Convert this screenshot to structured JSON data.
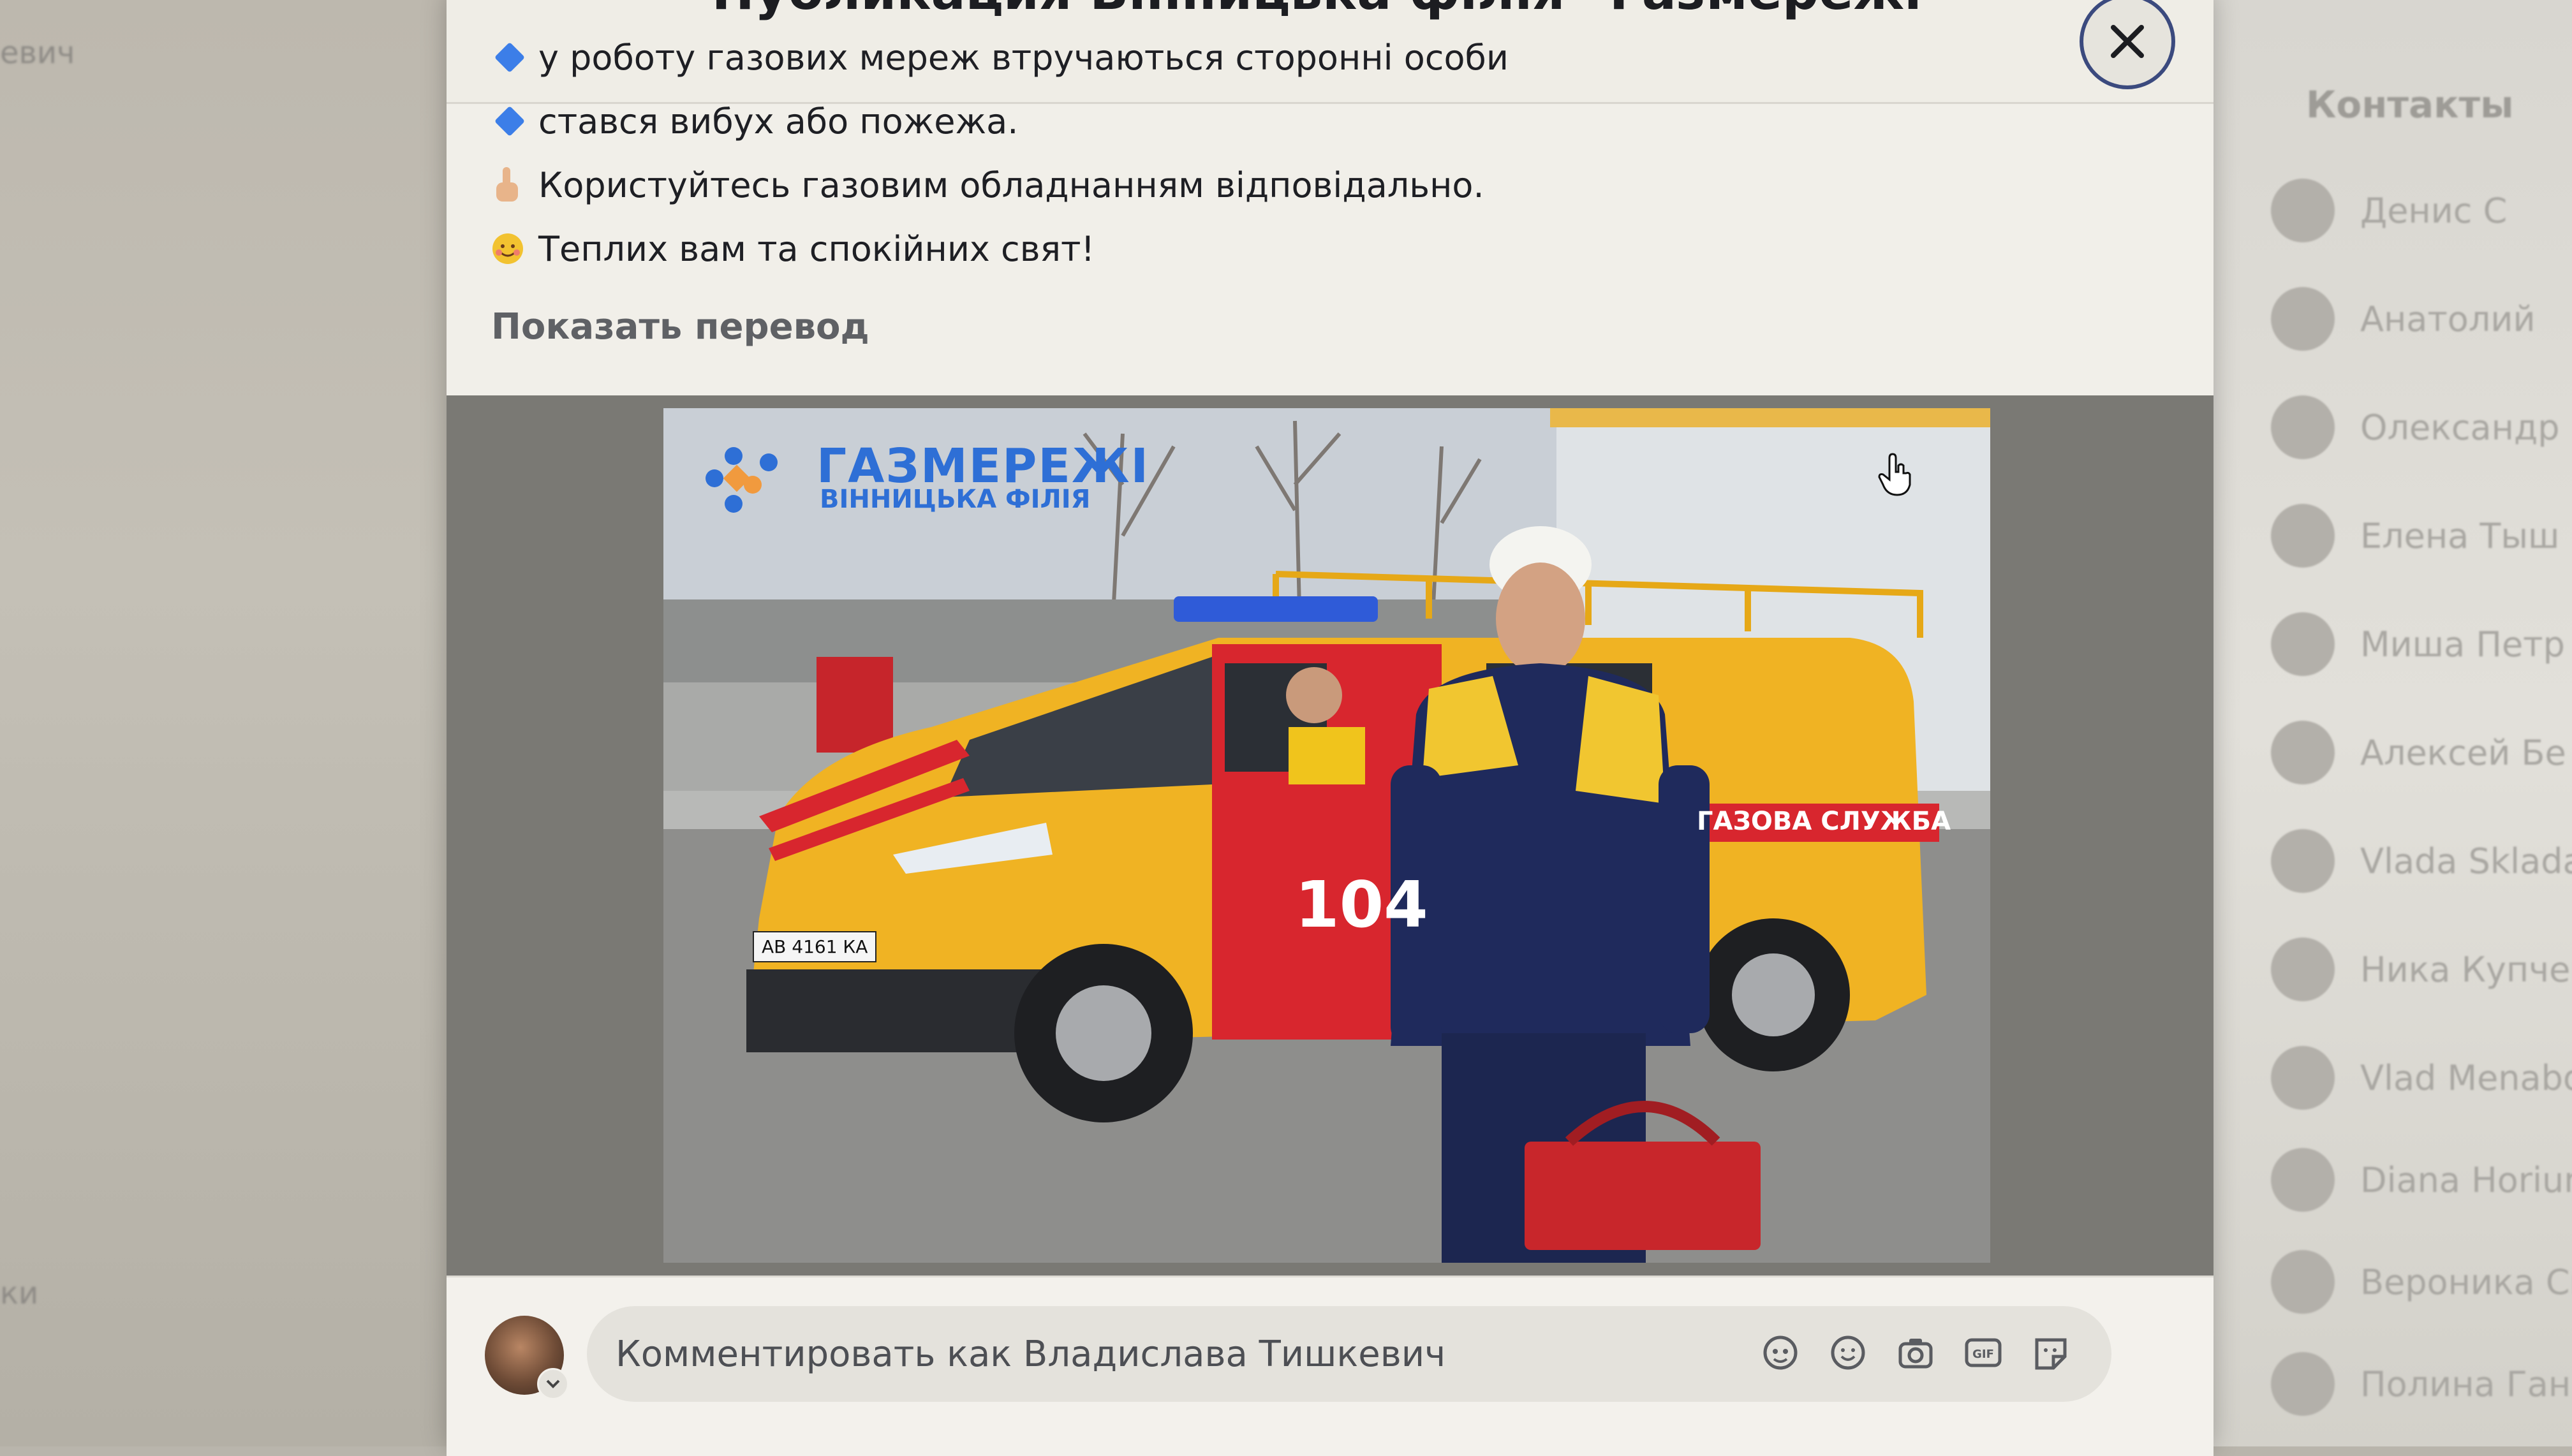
{
  "modal": {
    "title": "Публикация Вінницька філія \"Газмережі\"",
    "bullets": [
      "у роботу газових мереж втручаються сторонні особи",
      "стався вибух або пожежа."
    ],
    "advice": "Користуйтесь газовим обладнанням відповідально.",
    "greeting": "Теплих вам та спокійних свят!",
    "show_translation": "Показать перевод"
  },
  "photo": {
    "logo_main": "ГАЗМЕРЕЖІ",
    "logo_sub": "ВІННИЦЬКА ФІЛІЯ",
    "van_number": "104",
    "van_label": "ГАЗОВА СЛУЖБА",
    "plate": "АВ 4161 КА"
  },
  "comment": {
    "placeholder": "Комментировать как Владислава Тишкевич",
    "icons": [
      "avatar-sticker-icon",
      "emoji-icon",
      "camera-icon",
      "gif-icon",
      "sticker-icon"
    ]
  },
  "background": {
    "left_top": "евич",
    "left_bottom": "ки"
  },
  "contacts": {
    "title": "Контакты",
    "items": [
      "Денис С",
      "Анатолий",
      "Олександр",
      "Елена Тыш",
      "Миша Петр",
      "Алексей Бе",
      "Vlada Sklada",
      "Ника Купчен",
      "Vlad Menabd",
      "Diana Horiun",
      "Вероника См",
      "Полина Ганне"
    ]
  },
  "colors": {
    "accent_blue": "#3c7ee8",
    "van_yellow": "#f0b323",
    "van_red": "#d8262e",
    "uniform_navy": "#1f2a5c"
  }
}
